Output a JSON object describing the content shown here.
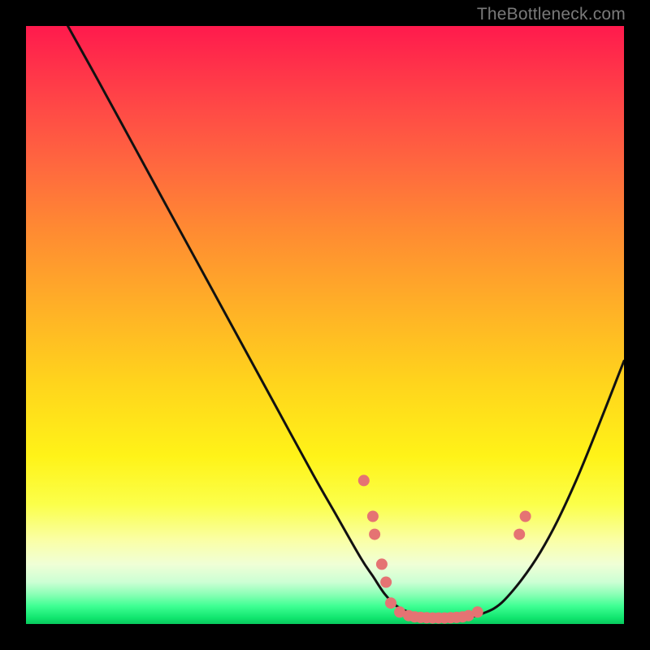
{
  "watermark": {
    "text": "TheBottleneck.com"
  },
  "chart_data": {
    "type": "line",
    "title": "",
    "xlabel": "",
    "ylabel": "",
    "xlim": [
      0,
      100
    ],
    "ylim": [
      0,
      100
    ],
    "grid": false,
    "legend": false,
    "curve_x": [
      7,
      12,
      18,
      24,
      30,
      36,
      42,
      48,
      52,
      56,
      58,
      60,
      62,
      64,
      66,
      68,
      70,
      72,
      74,
      76,
      80,
      86,
      92,
      100
    ],
    "curve_y": [
      100,
      91,
      80,
      69,
      58,
      47,
      36,
      25,
      18,
      11,
      8,
      5,
      3,
      2,
      1.5,
      1.2,
      1,
      1,
      1.2,
      1.6,
      4,
      12,
      24,
      44
    ],
    "markers": [
      {
        "x": 56.5,
        "y": 24
      },
      {
        "x": 58.0,
        "y": 18
      },
      {
        "x": 58.3,
        "y": 15
      },
      {
        "x": 59.5,
        "y": 10
      },
      {
        "x": 60.2,
        "y": 7
      },
      {
        "x": 61.0,
        "y": 3.5
      },
      {
        "x": 62.5,
        "y": 2
      },
      {
        "x": 64.0,
        "y": 1.4
      },
      {
        "x": 65.0,
        "y": 1.2
      },
      {
        "x": 66.0,
        "y": 1.1
      },
      {
        "x": 67.0,
        "y": 1.05
      },
      {
        "x": 68.0,
        "y": 1.0
      },
      {
        "x": 69.0,
        "y": 1.0
      },
      {
        "x": 70.0,
        "y": 1.0
      },
      {
        "x": 71.0,
        "y": 1.05
      },
      {
        "x": 72.0,
        "y": 1.1
      },
      {
        "x": 73.0,
        "y": 1.2
      },
      {
        "x": 74.0,
        "y": 1.4
      },
      {
        "x": 75.5,
        "y": 2.0
      },
      {
        "x": 82.5,
        "y": 15
      },
      {
        "x": 83.5,
        "y": 18
      }
    ],
    "curve_color": "#111111",
    "marker_color": "#e57373",
    "marker_radius": 7
  }
}
